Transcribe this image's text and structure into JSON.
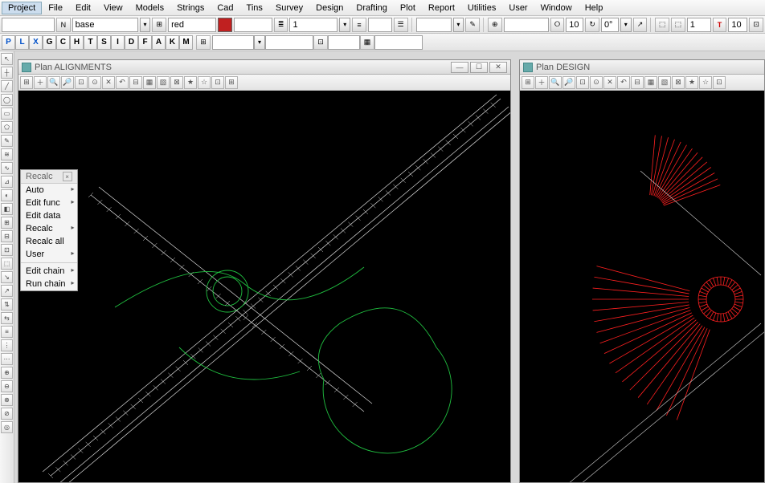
{
  "menubar": [
    "Project",
    "File",
    "Edit",
    "View",
    "Models",
    "Strings",
    "Cad",
    "Tins",
    "Survey",
    "Design",
    "Drafting",
    "Plot",
    "Report",
    "Utilities",
    "User",
    "Window",
    "Help"
  ],
  "menubar_active": 0,
  "props": {
    "input1": "",
    "n_btn": "N",
    "layer": "base",
    "color_name": "red",
    "color_hex": "#c02020",
    "weight": "1",
    "num_a": "10",
    "angle": "0°",
    "t_label": "T",
    "num_b": "1",
    "num_c": "10"
  },
  "snap_letters": [
    "P",
    "L",
    "X",
    "G",
    "C",
    "H",
    "T",
    "S",
    "I",
    "D",
    "F",
    "A",
    "K",
    "M"
  ],
  "snap_blue": [
    0,
    1,
    2
  ],
  "recalc_menu": {
    "title": "Recalc",
    "items": [
      {
        "label": "Auto",
        "sub": true
      },
      {
        "label": "Edit func",
        "sub": true
      },
      {
        "label": "Edit data",
        "sub": false
      },
      {
        "label": "Recalc",
        "sub": true
      },
      {
        "label": "Recalc all",
        "sub": false
      },
      {
        "label": "User",
        "sub": true
      }
    ],
    "items2": [
      {
        "label": "Edit chain",
        "sub": true
      },
      {
        "label": "Run chain",
        "sub": true
      }
    ]
  },
  "windows": {
    "left": {
      "title": "Plan ALIGNMENTS"
    },
    "right": {
      "title": "Plan DESIGN"
    }
  },
  "winbtns": {
    "min": "—",
    "max": "☐",
    "close": "✕"
  }
}
